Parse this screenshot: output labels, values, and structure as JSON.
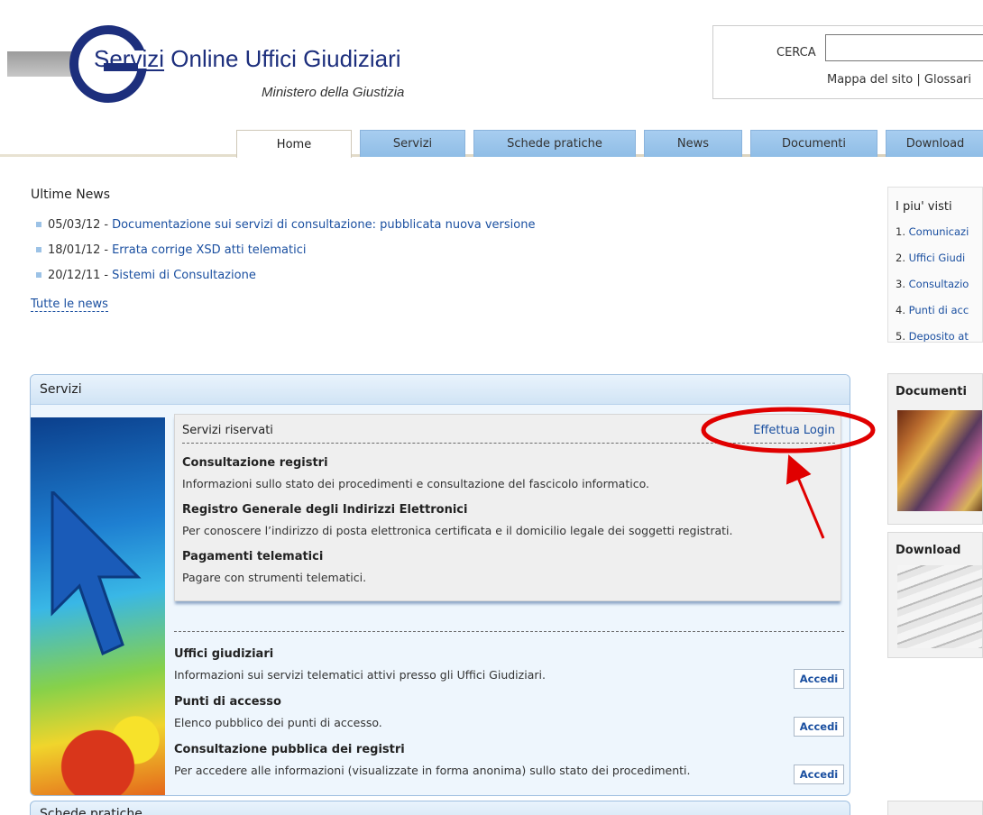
{
  "header": {
    "logo_title_prefix": "Ser",
    "logo_title_underlined": "vizi",
    "logo_title_rest": " Online ",
    "logo_title_brand": "Uffici Giudiziari",
    "logo_subtitle": "Ministero della Giustizia",
    "logo_icon": "g-logo-icon"
  },
  "search": {
    "label": "CERCA",
    "value": "",
    "placeholder": "",
    "link_map": "Mappa del sito",
    "link_separator": "|",
    "link_glossary": "Glossari"
  },
  "nav": {
    "tabs": [
      {
        "label": "Home",
        "active": true
      },
      {
        "label": "Servizi"
      },
      {
        "label": "Schede pratiche"
      },
      {
        "label": "News"
      },
      {
        "label": "Documenti"
      },
      {
        "label": "Download"
      }
    ]
  },
  "news": {
    "title": "Ultime News",
    "separator": "-",
    "items": [
      {
        "date": "05/03/12",
        "text": "Documentazione sui servizi di consultazione: pubblicata nuova versione"
      },
      {
        "date": "18/01/12",
        "text": "Errata corrige XSD atti telematici"
      },
      {
        "date": "20/12/11",
        "text": "Sistemi di Consultazione"
      }
    ],
    "all_link": "Tutte le news"
  },
  "servizi": {
    "title": "Servizi",
    "riservati": {
      "title": "Servizi riservati",
      "login_label": "Effettua Login",
      "items": [
        {
          "title": "Consultazione registri",
          "desc": "Informazioni sullo stato dei procedimenti e consultazione del fascicolo informatico."
        },
        {
          "title": "Registro Generale degli Indirizzi Elettronici",
          "desc": "Per conoscere l’indirizzo di posta elettronica certificata e il domicilio legale dei soggetti registrati."
        },
        {
          "title": "Pagamenti telematici",
          "desc": "Pagare con strumenti telematici."
        }
      ]
    },
    "pubblici": [
      {
        "title": "Uffici giudiziari",
        "desc": "Informazioni sui servizi telematici attivi presso gli Uffici Giudiziari.",
        "button": "Accedi"
      },
      {
        "title": "Punti di accesso",
        "desc": "Elenco pubblico dei punti di accesso.",
        "button": "Accedi"
      },
      {
        "title": "Consultazione pubblica dei registri",
        "desc": "Per accedere alle informazioni (visualizzate in forma anonima) sullo stato dei procedimenti.",
        "button": "Accedi"
      }
    ]
  },
  "schede": {
    "title": "Schede pratiche"
  },
  "sidebar": {
    "piu_visti": {
      "title": "I piu' visti",
      "items": [
        {
          "num": "1.",
          "label": "Comunicazi"
        },
        {
          "num": "2.",
          "label": "Uffici Giudi"
        },
        {
          "num": "3.",
          "label": "Consultazio"
        },
        {
          "num": "4.",
          "label": "Punti di acc"
        },
        {
          "num": "5.",
          "label": "Deposito at"
        }
      ]
    },
    "documenti": {
      "title": "Documenti"
    },
    "download": {
      "title": "Download"
    }
  },
  "colors": {
    "link": "#1a4fa0",
    "tab": "#9cc6ee",
    "panel_border": "#9fbfe0",
    "annotation": "#e00000",
    "brand": "#1d2f7d"
  }
}
